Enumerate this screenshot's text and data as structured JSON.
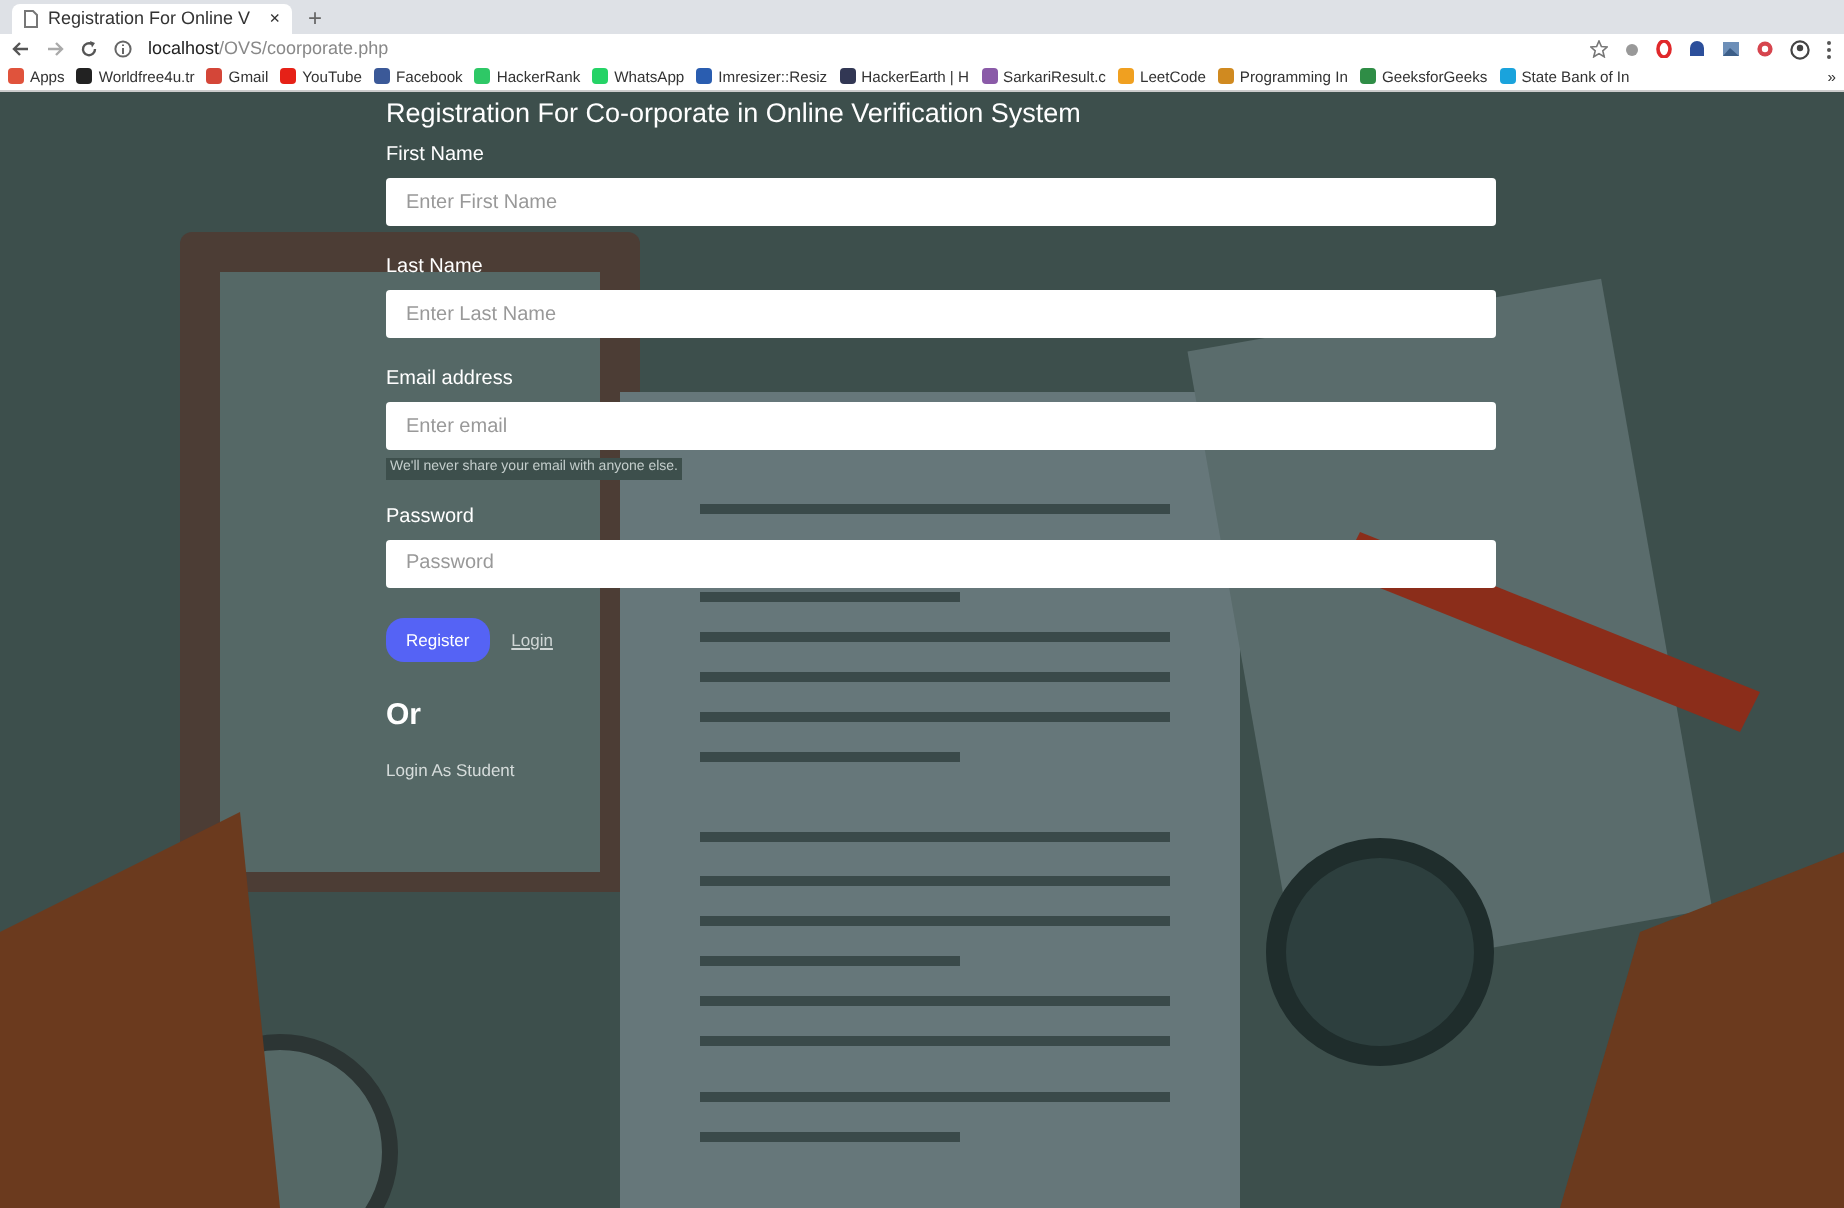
{
  "browser": {
    "tab": {
      "title": "Registration For Online V",
      "close": "×"
    },
    "new_tab": "+",
    "address": {
      "host": "localhost",
      "path": "/OVS/coorporate.php"
    },
    "bookmarks": [
      {
        "label": "Apps",
        "color": "#e0533c"
      },
      {
        "label": "Worldfree4u.tr",
        "color": "#222222"
      },
      {
        "label": "Gmail",
        "color": "#d44638"
      },
      {
        "label": "YouTube",
        "color": "#e62117"
      },
      {
        "label": "Facebook",
        "color": "#3b5998"
      },
      {
        "label": "HackerRank",
        "color": "#2ec866"
      },
      {
        "label": "WhatsApp",
        "color": "#25d366"
      },
      {
        "label": "Imresizer::Resiz",
        "color": "#2a5db0"
      },
      {
        "label": "HackerEarth | H",
        "color": "#323754"
      },
      {
        "label": "SarkariResult.c",
        "color": "#8a5aa8"
      },
      {
        "label": "LeetCode",
        "color": "#f0a020"
      },
      {
        "label": "Programming In",
        "color": "#d08a20"
      },
      {
        "label": "GeeksforGeeks",
        "color": "#2f8d46"
      },
      {
        "label": "State Bank of In",
        "color": "#1aa3dc"
      }
    ],
    "more": "»"
  },
  "page": {
    "title": "Registration For Co-orporate in Online Verification System",
    "fields": [
      {
        "label": "First Name",
        "placeholder": "Enter First Name"
      },
      {
        "label": "Last Name",
        "placeholder": "Enter Last Name"
      },
      {
        "label": "Email address",
        "placeholder": "Enter email",
        "help": "We'll never share your email with anyone else."
      },
      {
        "label": "Password",
        "placeholder": "Password"
      }
    ],
    "register_button": "Register",
    "login_link": "Login",
    "or": "Or",
    "student_link": "Login As Student"
  }
}
